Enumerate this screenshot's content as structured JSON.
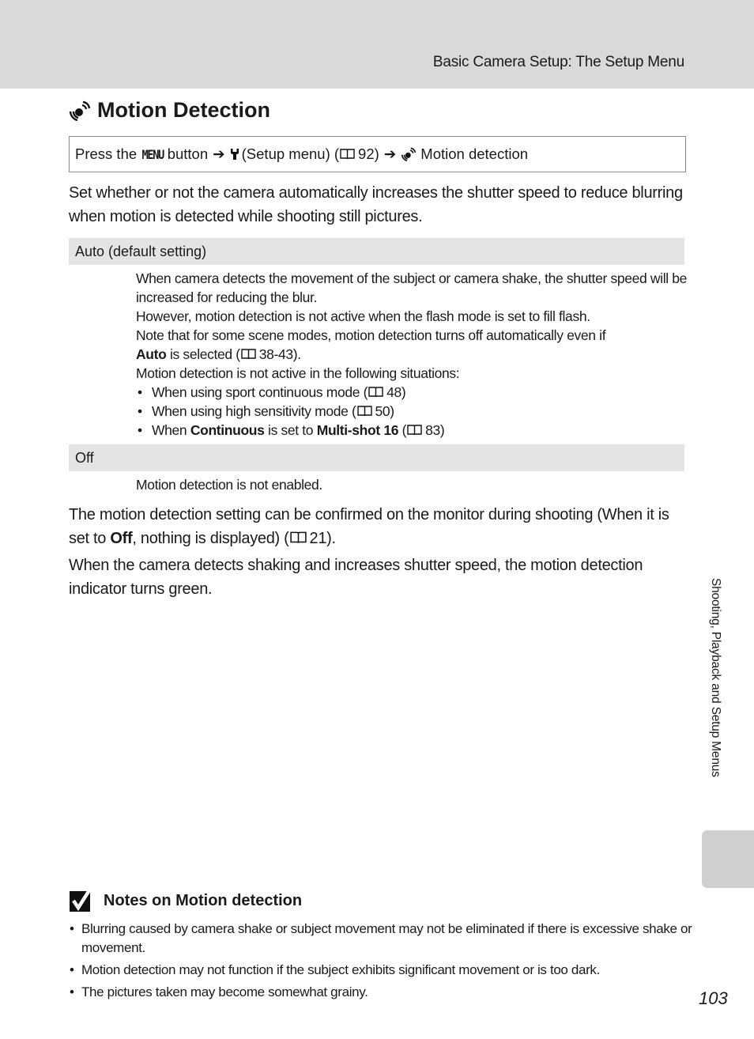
{
  "header": {
    "section_title": "Basic Camera Setup: The Setup Menu"
  },
  "page": {
    "title": "Motion Detection",
    "title_icon": "motion-detection-icon"
  },
  "nav_path": {
    "press_the": "Press the",
    "menu_button": "MENU",
    "button_word": "button",
    "arrow1": "➔",
    "setup_icon": "wrench-icon",
    "setup_label": "(Setup menu) (",
    "setup_ref": "92)",
    "arrow2": "➔",
    "target_icon": "motion-detection-icon",
    "target_label": "Motion detection"
  },
  "intro": "Set whether or not the camera automatically increases the shutter speed to reduce blurring when motion is detected while shooting still pictures.",
  "options": [
    {
      "label": "Auto (default setting)",
      "lines": [
        "When camera detects the movement of the subject or camera shake, the shutter speed will be increased for reducing the blur.",
        "However, motion detection is not active when the flash mode is set to fill flash.",
        "Note that for some scene modes, motion detection turns off automatically even if"
      ],
      "auto_bold": "Auto",
      "auto_rest": " is selected (",
      "auto_ref": "38-43).",
      "situations_intro": "Motion detection is not active in the following situations:",
      "bullets": [
        {
          "text": "When using sport continuous mode (",
          "ref": "48)"
        },
        {
          "text": "When using high sensitivity mode (",
          "ref": "50)"
        },
        {
          "pre": "When ",
          "bold1": "Continuous",
          "mid": " is set to ",
          "bold2": "Multi-shot 16",
          "post": " (",
          "ref": "83)"
        }
      ]
    },
    {
      "label": "Off",
      "text": "Motion detection is not enabled."
    }
  ],
  "paragraphs": [
    {
      "pre": "The motion detection setting can be confirmed on the monitor during shooting (When it is set to ",
      "bold": "Off",
      "post": ", nothing is displayed) (",
      "ref": "21)."
    },
    {
      "text": "When the camera detects shaking and increases shutter speed, the motion detection indicator turns green."
    }
  ],
  "notes": {
    "title": "Notes on Motion detection",
    "items": [
      "Blurring caused by camera shake or subject movement may not be eliminated if there is excessive shake or movement.",
      "Motion detection may not function if the subject exhibits significant movement or is too dark.",
      "The pictures taken may become somewhat grainy."
    ]
  },
  "side_tab": {
    "label": "Shooting, Playback and Setup Menus"
  },
  "page_number": "103"
}
